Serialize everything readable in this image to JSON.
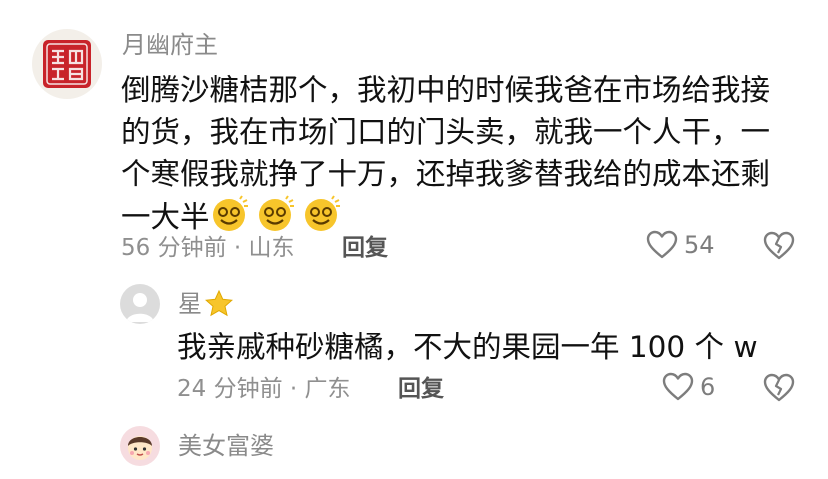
{
  "comments": [
    {
      "username": "月幽府主",
      "avatar_icon": "red-seal-avatar-icon",
      "lines": [
        "倒腾沙糖桔那个，我初中的时候我爸在市场给我接",
        "的货，我在市场门口的门头卖，就我一个人干，一",
        "个寒假我就挣了十万，还掉我爹替我给的成本还剩",
        "一大半"
      ],
      "emojis": [
        "dizzy-smile-emoji",
        "dizzy-smile-emoji",
        "dizzy-smile-emoji"
      ],
      "time_location": "56 分钟前 · 山东",
      "reply_label": "回复",
      "likes": "54"
    },
    {
      "username": "星",
      "username_emoji": "star-emoji",
      "avatar_icon": "default-avatar-icon",
      "lines": [
        "我亲戚种砂糖橘，不大的果园一年 100 个 w"
      ],
      "time_location": "24 分钟前 · 广东",
      "reply_label": "回复",
      "likes": "6"
    },
    {
      "username": "美女富婆",
      "avatar_icon": "cartoon-avatar-icon"
    }
  ],
  "colors": {
    "username": "#8a8a8a",
    "text": "#111111",
    "meta": "#8f8f8f",
    "seal_red": "#c8232a",
    "emoji_yellow": "#f7c52b"
  }
}
